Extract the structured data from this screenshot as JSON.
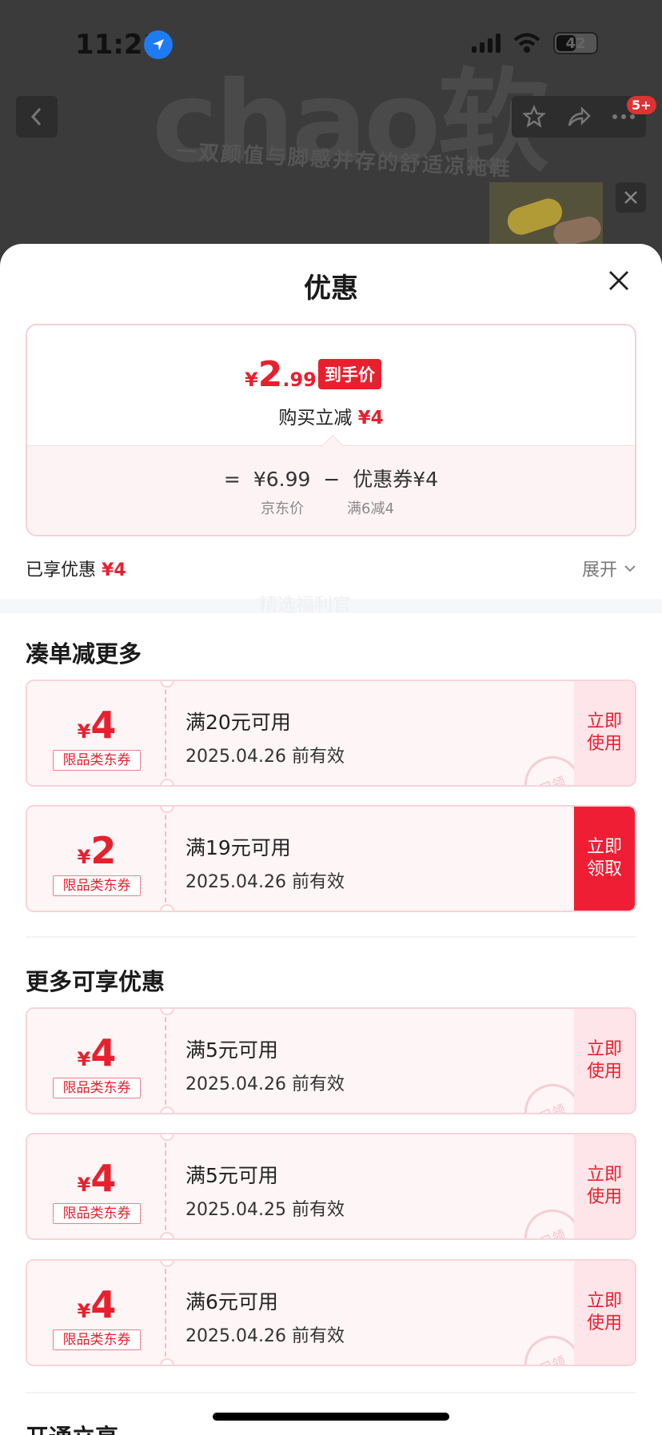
{
  "status_bar": {
    "time": "11:21",
    "battery": "42"
  },
  "background": {
    "banner_text": "chao软",
    "banner_sub": "一双颜值与脚感并存的舒适凉拖鞋",
    "badge": "5+"
  },
  "sheet": {
    "title": "优惠",
    "price_card": {
      "currency": "¥",
      "price_int": "2",
      "price_dec": ".99",
      "price_tag": "到手价",
      "reduce_label": "购买立减",
      "reduce_amount": "¥4",
      "eq": "=",
      "jd_price": "¥6.99",
      "minus": "−",
      "coupon_label": "优惠券¥4",
      "jd_price_label": "京东价",
      "coupon_rule": "满6减4"
    },
    "enjoyed": {
      "label": "已享优惠",
      "amount": "¥4",
      "expand": "展开"
    }
  },
  "section1": {
    "title": "凑单减更多",
    "watermark": "精选福利官",
    "coupons": [
      {
        "currency": "¥",
        "amount": "4",
        "tag": "限品类东券",
        "condition": "满20元可用",
        "date": "2025.04.26 前有效",
        "action": "立即使用",
        "stamp": "已领"
      },
      {
        "currency": "¥",
        "amount": "2",
        "tag": "限品类东券",
        "condition": "满19元可用",
        "date": "2025.04.26 前有效",
        "action": "立即领取",
        "stamp": ""
      }
    ]
  },
  "section2": {
    "title": "更多可享优惠",
    "coupons": [
      {
        "currency": "¥",
        "amount": "4",
        "tag": "限品类东券",
        "condition": "满5元可用",
        "date": "2025.04.26 前有效",
        "action": "立即使用",
        "stamp": "已领"
      },
      {
        "currency": "¥",
        "amount": "4",
        "tag": "限品类东券",
        "condition": "满5元可用",
        "date": "2025.04.25 前有效",
        "action": "立即使用",
        "stamp": "已领"
      },
      {
        "currency": "¥",
        "amount": "4",
        "tag": "限品类东券",
        "condition": "满6元可用",
        "date": "2025.04.26 前有效",
        "action": "立即使用",
        "stamp": "已领"
      }
    ]
  },
  "section3": {
    "title": "开通立享"
  },
  "colors": {
    "accent": "#e8202e",
    "card_border": "#f8d3da",
    "card_bg": "#fdf5f6"
  }
}
